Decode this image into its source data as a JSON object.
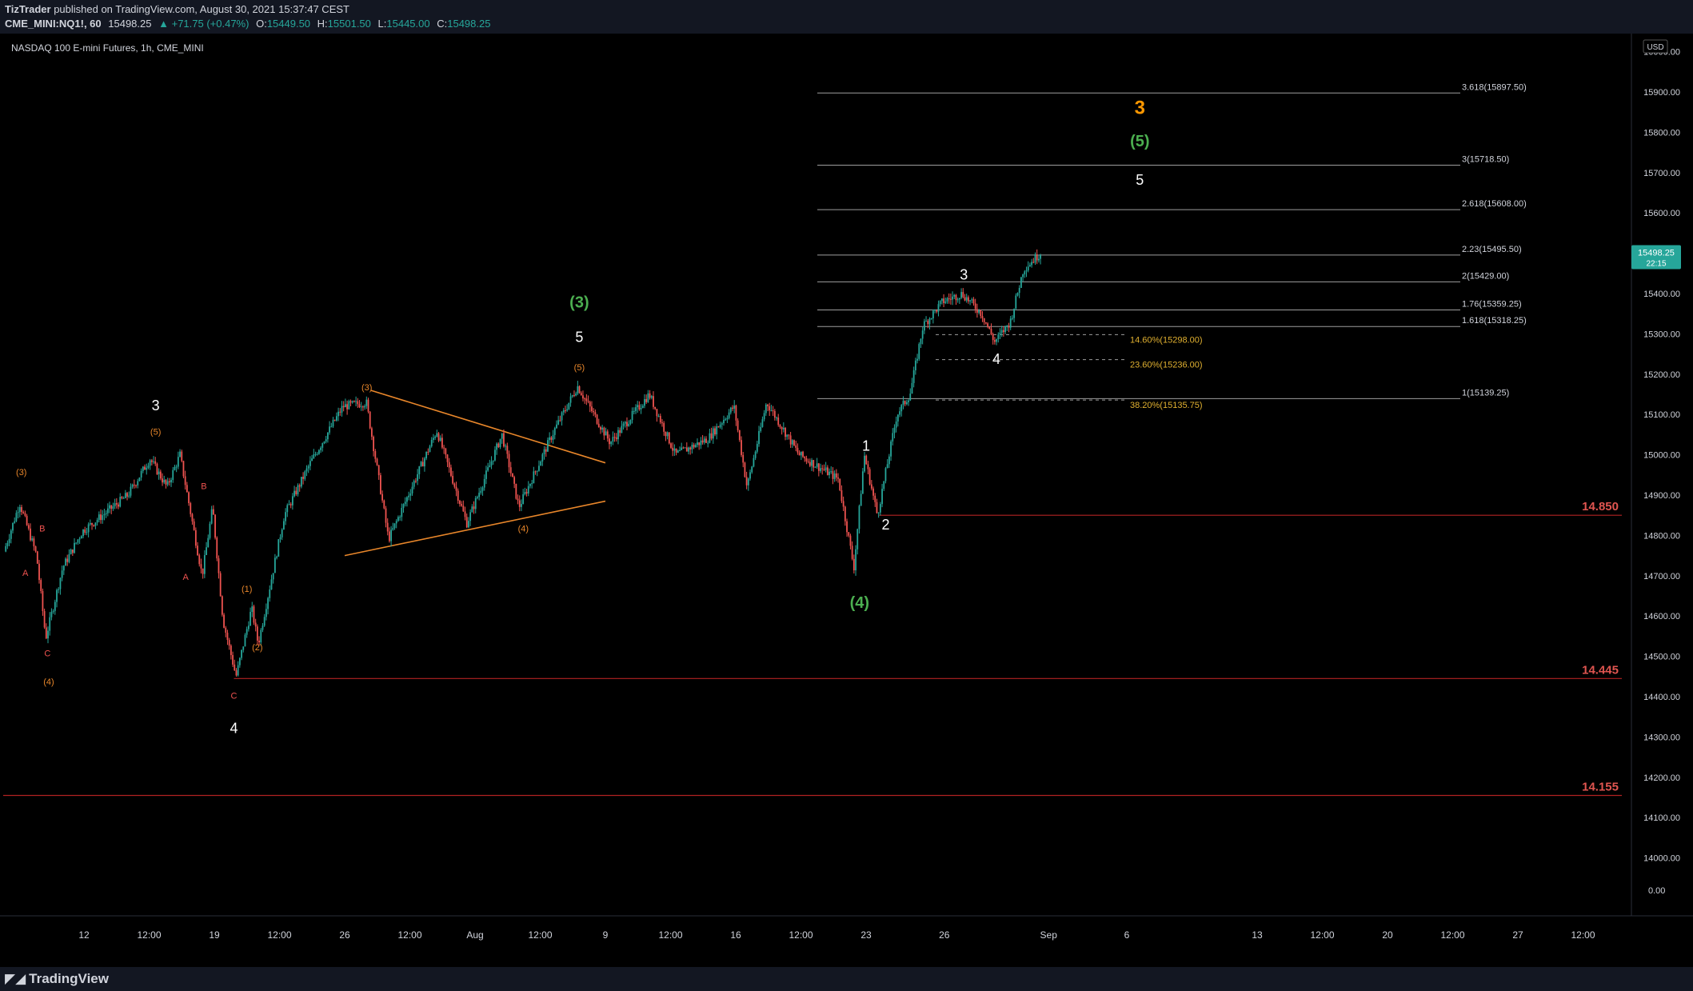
{
  "header": {
    "author": "TizTrader",
    "published_text": "published on TradingView.com, August 30, 2021 15:37:47 CEST",
    "symbol": "CME_MINI:NQ1!, 60",
    "last": "15498.25",
    "change": "▲ +71.75 (+0.47%)",
    "o_label": "O:",
    "o_value": "15449.50",
    "h_label": "H:",
    "h_value": "15501.50",
    "l_label": "L:",
    "l_value": "15445.00",
    "c_label": "C:",
    "c_value": "15498.25"
  },
  "footer": {
    "logo_text": "TradingView"
  },
  "colors": {
    "up": "#26a69a",
    "down": "#ef5350",
    "orange": "#e8862a",
    "green_wave": "#4caf50",
    "orange_bold": "#ff9800",
    "red_level": "#b22222",
    "fib_gold": "#e0b030",
    "price_tag": "#26a69a"
  },
  "chart_data": {
    "type": "candlestick",
    "title": "NASDAQ 100 E-mini Futures, 1h, CME_MINI",
    "currency": "USD",
    "y_range": [
      14000,
      16100
    ],
    "y_ticks": [
      14000,
      14100,
      14200,
      14300,
      14400,
      14500,
      14600,
      14700,
      14800,
      14900,
      15000,
      15100,
      15200,
      15300,
      15400,
      15500,
      15600,
      15700,
      15800,
      15900,
      16000,
      16100
    ],
    "y_bottom_label": "0.00",
    "x_ticks": [
      "12",
      "12:00",
      "19",
      "12:00",
      "26",
      "12:00",
      "Aug",
      "12:00",
      "9",
      "12:00",
      "16",
      "12:00",
      "23",
      "26",
      "Sep",
      "6",
      "13",
      "12:00",
      "20",
      "12:00",
      "27",
      "12:00"
    ],
    "x_tick_days": [
      0.0,
      0.5,
      1.0,
      1.5,
      2.0,
      2.5,
      3.0,
      3.5,
      4.0,
      4.5,
      5.0,
      5.5,
      6.0,
      6.6,
      7.4,
      8.0,
      9.0,
      9.5,
      10.0,
      10.5,
      11.0,
      11.5
    ],
    "price_path": [
      {
        "t": -0.6,
        "p": 14760
      },
      {
        "t": -0.48,
        "p": 14880
      },
      {
        "t": -0.35,
        "p": 14750
      },
      {
        "t": -0.28,
        "p": 14545
      },
      {
        "t": -0.15,
        "p": 14720
      },
      {
        "t": 0.0,
        "p": 14810
      },
      {
        "t": 0.35,
        "p": 14900
      },
      {
        "t": 0.52,
        "p": 14990
      },
      {
        "t": 0.65,
        "p": 14920
      },
      {
        "t": 0.75,
        "p": 15000
      },
      {
        "t": 0.92,
        "p": 14700
      },
      {
        "t": 1.0,
        "p": 14870
      },
      {
        "t": 1.08,
        "p": 14590
      },
      {
        "t": 1.18,
        "p": 14450
      },
      {
        "t": 1.3,
        "p": 14620
      },
      {
        "t": 1.35,
        "p": 14530
      },
      {
        "t": 1.55,
        "p": 14850
      },
      {
        "t": 1.75,
        "p": 14980
      },
      {
        "t": 2.0,
        "p": 15120
      },
      {
        "t": 2.18,
        "p": 15130
      },
      {
        "t": 2.35,
        "p": 14790
      },
      {
        "t": 2.72,
        "p": 15060
      },
      {
        "t": 2.95,
        "p": 14830
      },
      {
        "t": 3.22,
        "p": 15050
      },
      {
        "t": 3.35,
        "p": 14870
      },
      {
        "t": 3.62,
        "p": 15060
      },
      {
        "t": 3.8,
        "p": 15170
      },
      {
        "t": 4.05,
        "p": 15030
      },
      {
        "t": 4.35,
        "p": 15150
      },
      {
        "t": 4.55,
        "p": 15000
      },
      {
        "t": 4.8,
        "p": 15040
      },
      {
        "t": 5.0,
        "p": 15120
      },
      {
        "t": 5.1,
        "p": 14920
      },
      {
        "t": 5.25,
        "p": 15130
      },
      {
        "t": 5.5,
        "p": 15000
      },
      {
        "t": 5.8,
        "p": 14940
      },
      {
        "t": 5.92,
        "p": 14720
      },
      {
        "t": 6.0,
        "p": 15000
      },
      {
        "t": 6.1,
        "p": 14850
      },
      {
        "t": 6.25,
        "p": 15100
      },
      {
        "t": 6.35,
        "p": 15150
      },
      {
        "t": 6.45,
        "p": 15320
      },
      {
        "t": 6.6,
        "p": 15380
      },
      {
        "t": 6.75,
        "p": 15400
      },
      {
        "t": 6.9,
        "p": 15350
      },
      {
        "t": 7.0,
        "p": 15280
      },
      {
        "t": 7.12,
        "p": 15330
      },
      {
        "t": 7.22,
        "p": 15460
      },
      {
        "t": 7.35,
        "p": 15500
      }
    ],
    "fib_levels": [
      {
        "label": "3.618(15897.50)",
        "price": 15897.5
      },
      {
        "label": "3(15718.50)",
        "price": 15718.5
      },
      {
        "label": "2.618(15608.00)",
        "price": 15608.0
      },
      {
        "label": "2.23(15495.50)",
        "price": 15495.5
      },
      {
        "label": "2(15429.00)",
        "price": 15429.0
      },
      {
        "label": "1.76(15359.25)",
        "price": 15359.25
      },
      {
        "label": "1.618(15318.25)",
        "price": 15318.25
      },
      {
        "label": "1(15139.25)",
        "price": 15139.25
      }
    ],
    "retracements": [
      {
        "label": "14.60%(15298.00)",
        "price": 15298.0
      },
      {
        "label": "23.60%(15236.00)",
        "price": 15236.0
      },
      {
        "label": "38.20%(15135.75)",
        "price": 15135.75
      }
    ],
    "levels": [
      {
        "label": "14.850",
        "price": 14850,
        "t_start": 6.1
      },
      {
        "label": "14.445",
        "price": 14445,
        "t_start": 1.15
      },
      {
        "label": "14.155",
        "price": 14155,
        "t_start": -0.62
      }
    ],
    "current_price": {
      "value": "15498.25",
      "countdown": "22:15",
      "price": 15498.25
    },
    "triangle": {
      "upper": [
        {
          "t": 2.2,
          "p": 15160
        },
        {
          "t": 4.0,
          "p": 14980
        }
      ],
      "lower": [
        {
          "t": 2.0,
          "p": 14750
        },
        {
          "t": 4.0,
          "p": 14885
        }
      ]
    },
    "annotations": [
      {
        "text": "3",
        "t": 0.55,
        "p": 15110,
        "color": "white",
        "size": 18
      },
      {
        "text": "(5)",
        "t": 0.55,
        "p": 15050,
        "color": "orange",
        "size": 11
      },
      {
        "text": "(3)",
        "t": -0.48,
        "p": 14950,
        "color": "orange",
        "size": 11
      },
      {
        "text": "B",
        "t": -0.32,
        "p": 14810,
        "color": "red",
        "size": 11
      },
      {
        "text": "A",
        "t": -0.45,
        "p": 14700,
        "color": "red",
        "size": 11
      },
      {
        "text": "C",
        "t": -0.28,
        "p": 14500,
        "color": "red",
        "size": 11
      },
      {
        "text": "(4)",
        "t": -0.27,
        "p": 14430,
        "color": "orange",
        "size": 11
      },
      {
        "text": "B",
        "t": 0.92,
        "p": 14915,
        "color": "red",
        "size": 11
      },
      {
        "text": "A",
        "t": 0.78,
        "p": 14690,
        "color": "red",
        "size": 11
      },
      {
        "text": "(1)",
        "t": 1.25,
        "p": 14660,
        "color": "orange",
        "size": 11
      },
      {
        "text": "(2)",
        "t": 1.33,
        "p": 14515,
        "color": "orange",
        "size": 11
      },
      {
        "text": "C",
        "t": 1.15,
        "p": 14395,
        "color": "red",
        "size": 11
      },
      {
        "text": "4",
        "t": 1.15,
        "p": 14310,
        "color": "white",
        "size": 18
      },
      {
        "text": "(3)",
        "t": 2.17,
        "p": 15160,
        "color": "orange",
        "size": 11
      },
      {
        "text": "(4)",
        "t": 3.37,
        "p": 14810,
        "color": "orange",
        "size": 11
      },
      {
        "text": "(5)",
        "t": 3.8,
        "p": 15210,
        "color": "orange",
        "size": 11
      },
      {
        "text": "5",
        "t": 3.8,
        "p": 15280,
        "color": "white",
        "size": 18
      },
      {
        "text": "(3)",
        "t": 3.8,
        "p": 15365,
        "color": "green",
        "size": 20
      },
      {
        "text": "(4)",
        "t": 5.95,
        "p": 14620,
        "color": "green",
        "size": 20
      },
      {
        "text": "1",
        "t": 6.0,
        "p": 15010,
        "color": "white",
        "size": 18
      },
      {
        "text": "2",
        "t": 6.15,
        "p": 14815,
        "color": "white",
        "size": 18
      },
      {
        "text": "3",
        "t": 6.75,
        "p": 15435,
        "color": "white",
        "size": 18
      },
      {
        "text": "4",
        "t": 7.0,
        "p": 15225,
        "color": "white",
        "size": 18
      },
      {
        "text": "3",
        "t": 8.1,
        "p": 15845,
        "color": "orange_bold",
        "size": 24
      },
      {
        "text": "(5)",
        "t": 8.1,
        "p": 15765,
        "color": "green",
        "size": 20
      },
      {
        "text": "5",
        "t": 8.1,
        "p": 15670,
        "color": "white",
        "size": 18
      }
    ]
  }
}
